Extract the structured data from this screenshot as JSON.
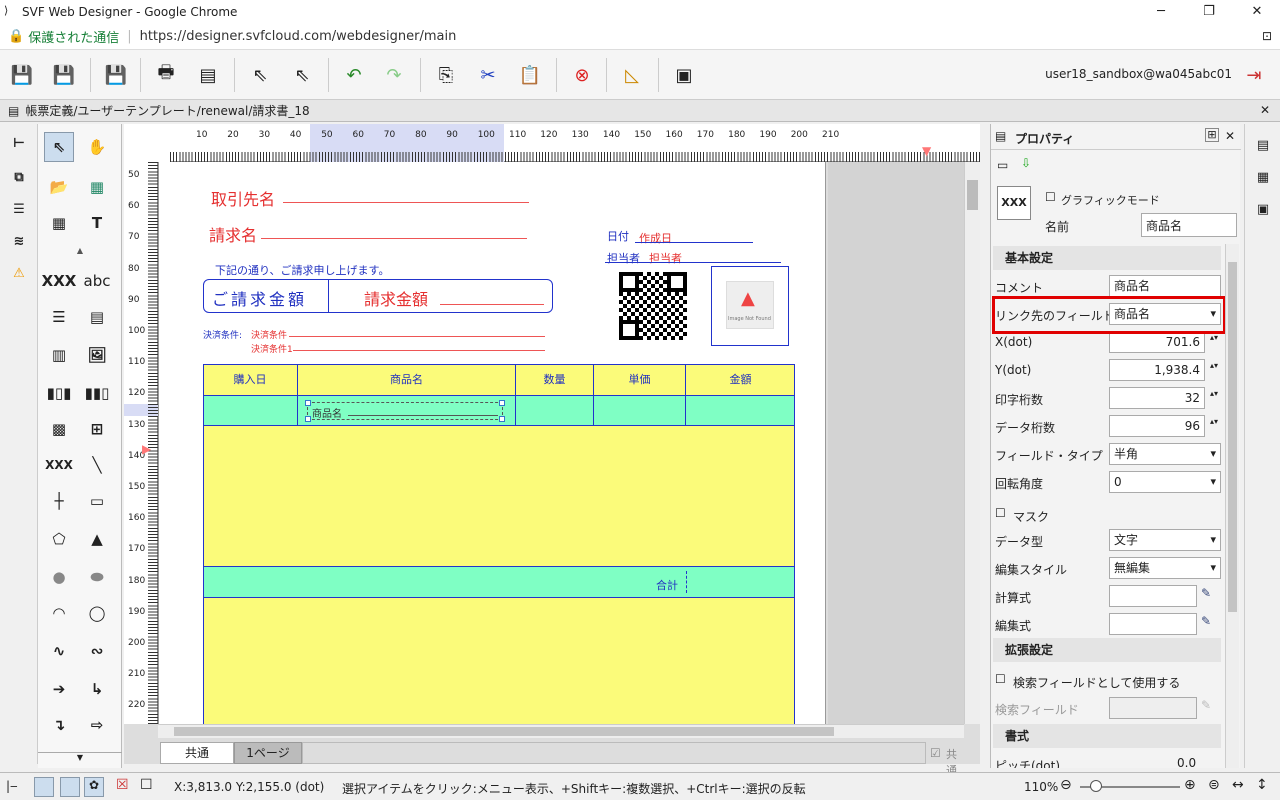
{
  "window": {
    "title": "SVF Web Designer - Google Chrome"
  },
  "urlbar": {
    "secure": "保護された通信",
    "url": "https://designer.svfcloud.com/webdesigner/main"
  },
  "toolbar": {
    "user": "user18_sandbox@wa045abc01"
  },
  "tab": {
    "path": "帳票定義/ユーザーテンプレート/renewal/請求書_18"
  },
  "ruler": {
    "top": [
      "10",
      "20",
      "30",
      "40",
      "50",
      "60",
      "70",
      "80",
      "90",
      "100",
      "110",
      "120",
      "130",
      "140",
      "150",
      "160",
      "170",
      "180",
      "190",
      "200",
      "210"
    ],
    "left": [
      "50",
      "60",
      "70",
      "80",
      "90",
      "100",
      "110",
      "120",
      "130",
      "140",
      "150",
      "160",
      "170",
      "180",
      "190",
      "200",
      "210",
      "220"
    ]
  },
  "palette": {
    "xxx": "XXX",
    "abc": "abc"
  },
  "form": {
    "torihiki": "取引先名",
    "seikyu": "請求名",
    "hizuke_label": "日付",
    "hizuke_value": "作成日",
    "tanto_label": "担当者",
    "tanto_value": "担当者",
    "message": "下記の通り、ご請求申し上げます。",
    "amount_label": "ご請求金額",
    "amount_value": "請求金額",
    "payment_label": "決済条件:",
    "payment_value1": "決済条件",
    "payment_value2": "決済条件1",
    "image_alt": "Image Not Found",
    "headers": [
      "購入日",
      "商品名",
      "数量",
      "単価",
      "金額"
    ],
    "field": "商品名",
    "total": "合計"
  },
  "bottom_tabs": {
    "common": "共通",
    "page1": "1ページ",
    "checkbox": "共通"
  },
  "props": {
    "title": "プロパティ",
    "graphic_mode": "グラフィックモード",
    "name_label": "名前",
    "name_value": "商品名",
    "xxx": "XXX",
    "basic": "基本設定",
    "rows": [
      {
        "label": "コメント",
        "value": "商品名",
        "type": "text"
      },
      {
        "label": "リンク先のフィールド名",
        "value": "商品名",
        "type": "dd"
      },
      {
        "label": "X(dot)",
        "value": "701.6",
        "type": "spin"
      },
      {
        "label": "Y(dot)",
        "value": "1,938.4",
        "type": "spin"
      },
      {
        "label": "印字桁数",
        "value": "32",
        "type": "spin"
      },
      {
        "label": "データ桁数",
        "value": "96",
        "type": "spin"
      },
      {
        "label": "フィールド・タイプ",
        "value": "半角",
        "type": "dd"
      },
      {
        "label": "回転角度",
        "value": "0",
        "type": "dd"
      }
    ],
    "mask": "マスク",
    "rows2": [
      {
        "label": "データ型",
        "value": "文字"
      },
      {
        "label": "編集スタイル",
        "value": "無編集"
      }
    ],
    "calc": "計算式",
    "edit": "編集式",
    "ext": "拡張設定",
    "search_use": "検索フィールドとして使用する",
    "search_field": "検索フィールド",
    "format": "書式",
    "pitch": "ピッチ(dot)",
    "pitch_value": "0.0"
  },
  "status": {
    "coords": "X:3,813.0 Y:2,155.0 (dot)",
    "hint": "選択アイテムをクリック:メニュー表示、+Shiftキー:複数選択、+Ctrlキー:選択の反転",
    "zoom": "110%"
  },
  "colors": {
    "yellow": "#fbfb7a",
    "green": "#7fffc4",
    "blue": "#2030c0",
    "red": "#e53030",
    "highlight": "#e00000"
  }
}
